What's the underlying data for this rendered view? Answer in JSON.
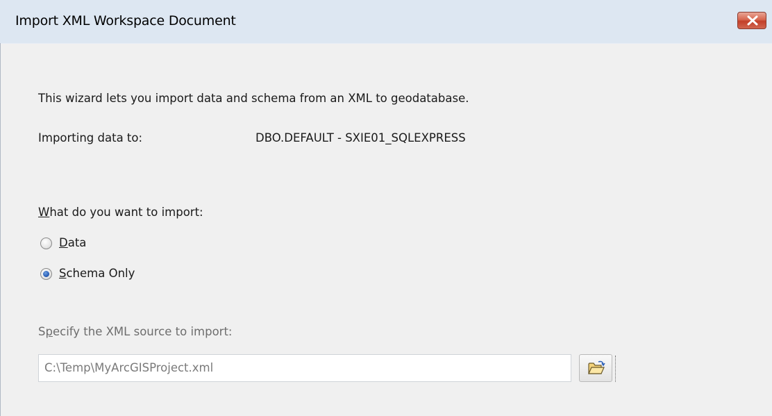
{
  "window": {
    "title": "Import XML Workspace Document"
  },
  "main": {
    "intro_text": "This wizard lets you import data and schema from an XML to geodatabase.",
    "importing_label": "Importing data to:",
    "importing_value": "DBO.DEFAULT - SXIE01_SQLEXPRESS",
    "question_prefix": "W",
    "question_rest": "hat do you want to import:",
    "options": [
      {
        "prefix": "D",
        "rest": "ata",
        "selected": false
      },
      {
        "prefix": "S",
        "rest": "chema Only",
        "selected": true
      }
    ],
    "source_label_pre": "S",
    "source_label_ul": "p",
    "source_label_rest": "ecify the XML source to import:",
    "source_value": "C:\\Temp\\MyArcGISProject.xml"
  },
  "icons": {
    "close": "close-icon",
    "browse": "open-folder-icon"
  },
  "colors": {
    "titlebar": "#dde7f2",
    "close_button": "#c9472f",
    "selected_radio": "#2a5fb8"
  }
}
